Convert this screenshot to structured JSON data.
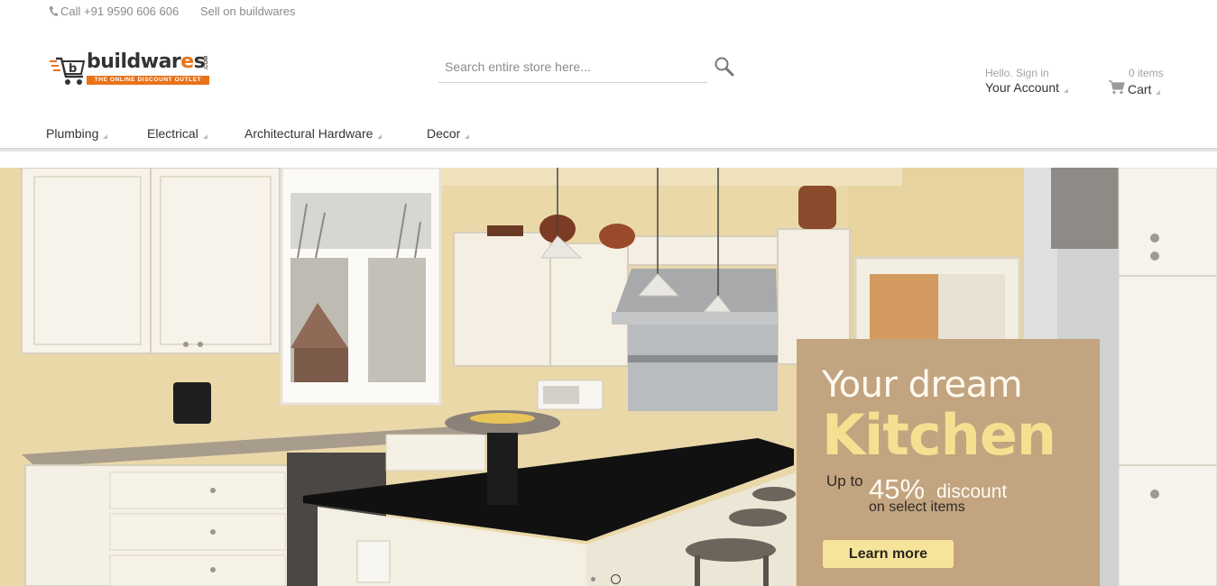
{
  "topbar": {
    "phone": "Call +91 9590 606 606",
    "sell": "Sell on buildwares"
  },
  "logo": {
    "word_a": "buildwar",
    "word_b": "e",
    "word_c": "s",
    "com": ".COM",
    "tagline": "THE ONLINE DISCOUNT OUTLET"
  },
  "search": {
    "placeholder": "Search entire store here..."
  },
  "account": {
    "hello": "Hello. Sign in",
    "label": "Your Account"
  },
  "cart": {
    "count": "0 items",
    "label": "Cart"
  },
  "nav": {
    "items": [
      {
        "label": "Plumbing"
      },
      {
        "label": "Electrical"
      },
      {
        "label": "Architectural Hardware"
      },
      {
        "label": "Decor"
      }
    ]
  },
  "banner": {
    "line1": "Your dream",
    "line2": "Kitchen",
    "upto": "Up to",
    "percent": "45%",
    "discount": "discount",
    "select": "on select items",
    "button": "Learn more"
  },
  "colors": {
    "brand_orange": "#e8731b",
    "promo_bg": "#c2a480",
    "promo_title": "#f4e090",
    "button_bg": "#f6e49a"
  },
  "slider": {
    "slides": 2,
    "active": 2
  }
}
